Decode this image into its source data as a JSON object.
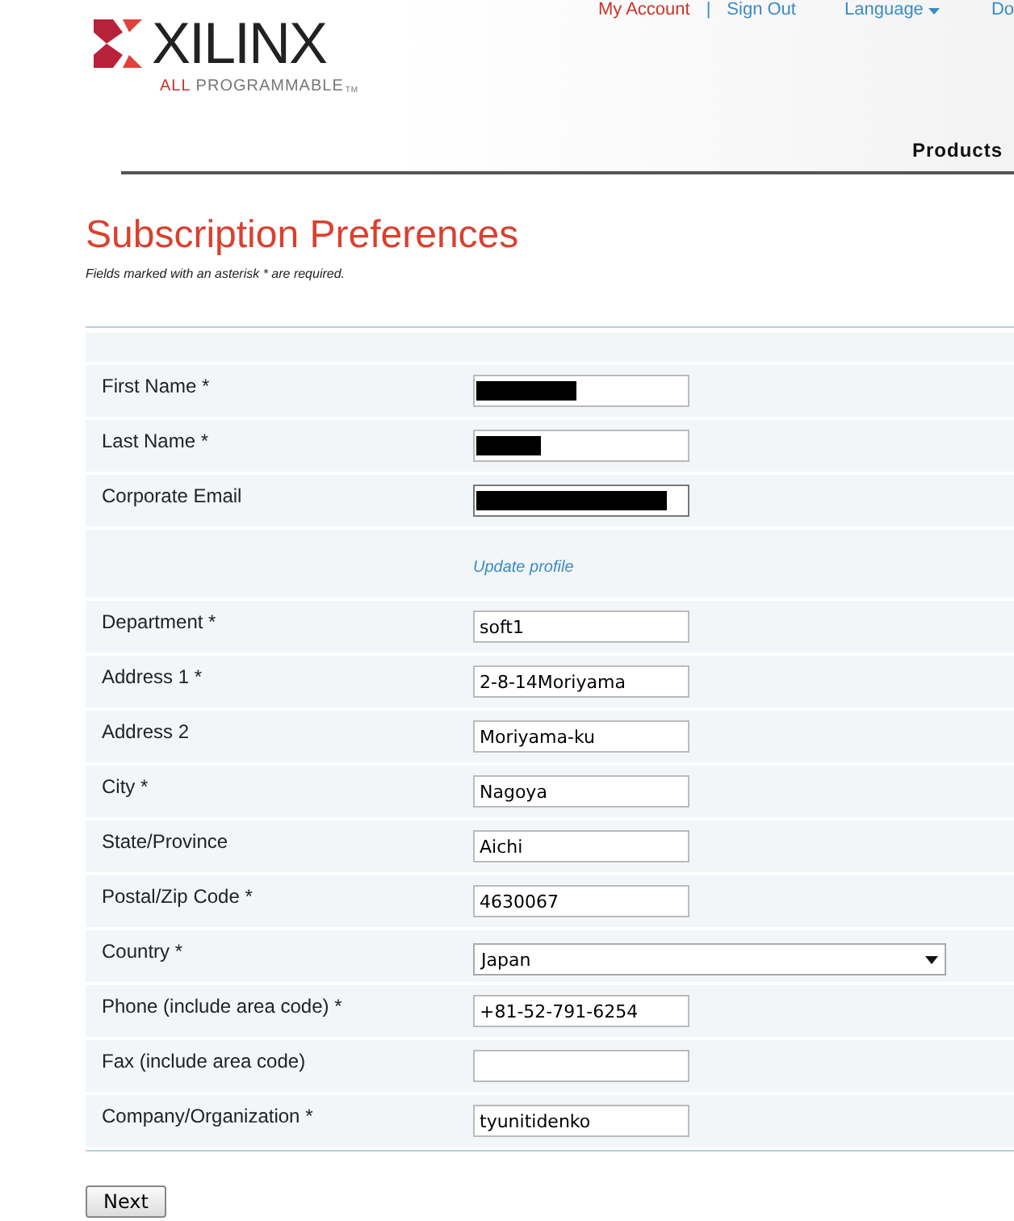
{
  "header": {
    "logo": {
      "wordmark": "XILINX",
      "tagline_accent": "ALL",
      "tagline": "PROGRAMMABLE",
      "trademark": "TM"
    },
    "top_links": [
      {
        "kind": "account",
        "label": "My Account"
      },
      {
        "kind": "separator",
        "label": "|"
      },
      {
        "kind": "link",
        "label": "Sign Out"
      },
      {
        "kind": "menu",
        "label": "Language"
      },
      {
        "kind": "link",
        "label": "Do"
      }
    ],
    "nav": [
      "Products"
    ]
  },
  "page": {
    "title": "Subscription Preferences",
    "note": "Fields marked with an asterisk * are required."
  },
  "form": {
    "rows": [
      {
        "kind": "redacted",
        "label": "First Name *"
      },
      {
        "kind": "redacted",
        "label": "Last Name *"
      },
      {
        "kind": "redacted",
        "label": "Corporate Email"
      },
      {
        "kind": "link",
        "label": "Update profile"
      },
      {
        "kind": "text",
        "label": "Department *",
        "value": "soft1"
      },
      {
        "kind": "text",
        "label": "Address 1 *",
        "value": "2-8-14Moriyama"
      },
      {
        "kind": "text",
        "label": "Address 2",
        "value": "Moriyama-ku"
      },
      {
        "kind": "text",
        "label": "City *",
        "value": "Nagoya"
      },
      {
        "kind": "text",
        "label": "State/Province",
        "value": "Aichi"
      },
      {
        "kind": "text",
        "label": "Postal/Zip Code *",
        "value": "4630067"
      },
      {
        "kind": "select",
        "label": "Country *",
        "value": "Japan"
      },
      {
        "kind": "text",
        "label": "Phone (include area code) *",
        "value": "+81-52-791-6254"
      },
      {
        "kind": "text",
        "label": "Fax (include area code)"
      },
      {
        "kind": "text",
        "label": "Company/Organization *",
        "value": "tyunitidenko"
      }
    ]
  },
  "buttons": [
    "Next"
  ]
}
